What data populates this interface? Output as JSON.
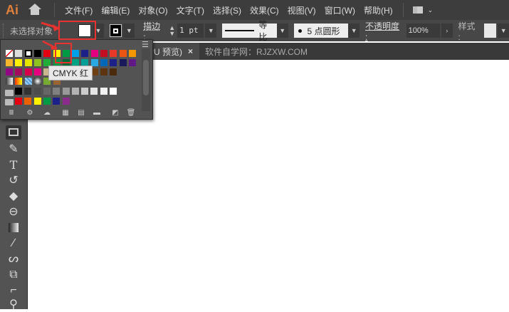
{
  "app": {
    "logo": "Ai"
  },
  "menu": [
    "文件(F)",
    "编辑(E)",
    "对象(O)",
    "文字(T)",
    "选择(S)",
    "效果(C)",
    "视图(V)",
    "窗口(W)",
    "帮助(H)"
  ],
  "control": {
    "selection_label": "未选择对象",
    "stroke_label": "描边 :",
    "stroke_value": "1 pt",
    "profile_label": "等比",
    "brush_label": "5 点圆形",
    "opacity_label": "不透明度 :",
    "opacity_value": "100%",
    "style_label": "样式 :"
  },
  "tabs": [
    {
      "label": "PU 预览)",
      "close": "×"
    },
    {
      "label": "软件自学网：RJZXW.COM"
    }
  ],
  "tooltip": "CMYK 红",
  "swatches": {
    "row1": [
      "#ffffff",
      "#ffffff",
      "#ffffff",
      "#000000",
      "#e50011",
      "#fff100",
      "#009944",
      "#00a0e9",
      "#1d2088",
      "#e4007f",
      "#c30d23",
      "#e83828",
      "#ea5514",
      "#f39800"
    ],
    "row2": [
      "#f8b62d",
      "#fff100",
      "#e5e500",
      "#8fc31f",
      "#22ac38",
      "#009944",
      "#006934",
      "#00a381",
      "#009e96",
      "#29a9e0",
      "#0068b7",
      "#1d2088",
      "#181a5a",
      "#601986"
    ],
    "row3": [
      "#920783",
      "#a40b5d",
      "#d7004b",
      "#e4007f",
      "#c9b68f",
      "#a68a64",
      "#8c6239",
      "#996633",
      "#8b5a2b",
      "#6f3f14",
      "#5d3410",
      "#4b2a0c"
    ],
    "gray": [
      "#000000",
      "#333333",
      "#4d4d4d",
      "#666666",
      "#808080",
      "#999999",
      "#b3b3b3",
      "#cccccc",
      "#e6e6e6",
      "#f2f2f2",
      "#ffffff"
    ],
    "group": [
      "#e50011",
      "#eb6100",
      "#fff100",
      "#009944",
      "#1d2088",
      "#8b2b8b"
    ]
  },
  "colors": {
    "accent": "#e8322f"
  }
}
